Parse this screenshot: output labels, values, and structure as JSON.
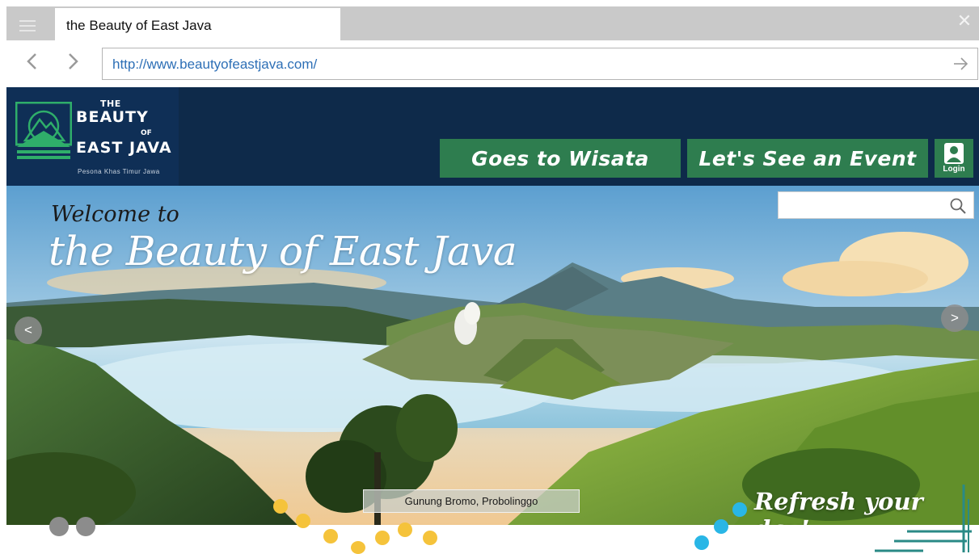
{
  "browser": {
    "tab_title": "the Beauty of East Java",
    "url": "http://www.beautyofeastjava.com/",
    "icons": [
      "menu-icon",
      "close-icon",
      "back-arrow-icon",
      "forward-arrow-icon",
      "go-arrow-icon"
    ]
  },
  "logo": {
    "the": "THE",
    "beauty": "BEAUTY",
    "of": "OF",
    "east_java": "EAST JAVA",
    "tagline": "Pesona Khas Timur Jawa"
  },
  "nav": {
    "wisata_label": "Goes to Wisata",
    "event_label": "Let's See an Event",
    "login_label": "Login"
  },
  "hero": {
    "welcome_small": "Welcome to",
    "welcome_big": "the Beauty of East Java",
    "search_placeholder": "",
    "prev_label": "<",
    "next_label": ">",
    "caption": "Gunung Bromo, Probolinggo",
    "slogan": "Refresh your day!"
  },
  "colors": {
    "header_bg": "#0e2a4a",
    "nav_green": "#2e7d4f",
    "link_blue": "#2d6fb6",
    "dot_yellow": "#f5c33b",
    "dot_cyan": "#29b6e6",
    "dot_gray": "#8c8c8c",
    "line_teal": "#2a8a86"
  }
}
